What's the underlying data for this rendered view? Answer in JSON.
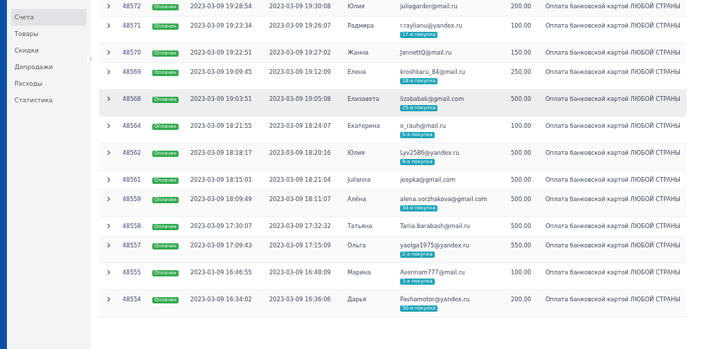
{
  "sidebar": {
    "items": [
      {
        "label": "Счета",
        "selected": true
      },
      {
        "label": "Товары",
        "selected": false
      },
      {
        "label": "Скидки",
        "selected": false
      },
      {
        "label": "Допродажи",
        "selected": false
      },
      {
        "label": "Расходы",
        "selected": false
      },
      {
        "label": "Статистика",
        "selected": false
      }
    ]
  },
  "table": {
    "rows": [
      {
        "id": "48572",
        "status": "Оплачен",
        "created": "2023-03-09 19:28:54",
        "paid": "2023-03-09 19:30:08",
        "name": "Юлия",
        "email": "juliagarder@mail.ru",
        "amount": "200.00",
        "payment": "Оплата банковской картой ЛЮБОЙ СТРАНЫ",
        "hovered": false
      },
      {
        "id": "48571",
        "status": "Оплачен",
        "created": "2023-03-09 19:23:34",
        "paid": "2023-03-09 19:26:07",
        "name": "Радмира",
        "email": "r.raylianu@yandex.ru",
        "badge": "17-я покупка",
        "amount": "100.00",
        "payment": "Оплата банковской картой ЛЮБОЙ СТРАНЫ",
        "hovered": false
      },
      {
        "id": "48570",
        "status": "Оплачен",
        "created": "2023-03-09 19:22:51",
        "paid": "2023-03-09 19:27:02",
        "name": "Жанна",
        "email": "JannettQ@mail.ru",
        "amount": "150.00",
        "payment": "Оплата банковской картой ЛЮБОЙ СТРАНЫ",
        "hovered": false
      },
      {
        "id": "48569",
        "status": "Оплачен",
        "created": "2023-03-09 19:09:45",
        "paid": "2023-03-09 19:12:09",
        "name": "Елена",
        "email": "kroshkaru_84@mail.ru",
        "badge": "18-я покупка",
        "amount": "250.00",
        "payment": "Оплата банковской картой ЛЮБОЙ СТРАНЫ",
        "hovered": false
      },
      {
        "id": "48568",
        "status": "Оплачен",
        "created": "2023-03-09 19:03:51",
        "paid": "2023-03-09 19:05:08",
        "name": "Елизавета",
        "email": "lizababak@gmail.com",
        "badge": "25-я покупка",
        "amount": "500.00",
        "payment": "Оплата банковской картой ЛЮБОЙ СТРАНЫ",
        "hovered": true
      },
      {
        "id": "48564",
        "status": "Оплачен",
        "created": "2023-03-09 18:21:55",
        "paid": "2023-03-09 18:24:07",
        "name": "Екатерина",
        "email": "e_rauh@mail.ru",
        "badge": "5-я покупка",
        "amount": "100.00",
        "payment": "Оплата банковской картой ЛЮБОЙ СТРАНЫ",
        "hovered": false
      },
      {
        "id": "48562",
        "status": "Оплачен",
        "created": "2023-03-09 18:18:17",
        "paid": "2023-03-09 18:20:16",
        "name": "Юлия",
        "email": "Lyv2586@yandex.ru",
        "badge": "9-я покупка",
        "amount": "500.00",
        "payment": "Оплата банковской картой ЛЮБОЙ СТРАНЫ",
        "hovered": false
      },
      {
        "id": "48561",
        "status": "Оплачен",
        "created": "2023-03-09 18:15:01",
        "paid": "2023-03-09 18:21:04",
        "name": "Julianna",
        "email": "jeepka@gmail.com",
        "amount": "500.00",
        "payment": "Оплата банковской картой ЛЮБОЙ СТРАНЫ",
        "hovered": false
      },
      {
        "id": "48559",
        "status": "Оплачен",
        "created": "2023-03-09 18:09:49",
        "paid": "2023-03-09 18:11:07",
        "name": "Алёна",
        "email": "alena.vorzhakova@gmail.com",
        "badge": "34-я покупка",
        "amount": "500.00",
        "payment": "Оплата банковской картой ЛЮБОЙ СТРАНЫ",
        "hovered": false
      },
      {
        "id": "48558",
        "status": "Оплачен",
        "created": "2023-03-09 17:30:07",
        "paid": "2023-03-09 17:32:32",
        "name": "Татьяна",
        "email": "Tania.barabash@mail.ru",
        "amount": "500.00",
        "payment": "Оплата банковской картой ЛЮБОЙ СТРАНЫ",
        "hovered": false
      },
      {
        "id": "48557",
        "status": "Оплачен",
        "created": "2023-03-09 17:09:43",
        "paid": "2023-03-09 17:15:09",
        "name": "Ольга",
        "email": "yaolga1975@yandex.ru",
        "badge": "2-я покупка",
        "amount": "550.00",
        "payment": "Оплата банковской картой ЛЮБОЙ СТРАНЫ",
        "hovered": false
      },
      {
        "id": "48555",
        "status": "Оплачен",
        "created": "2023-03-09 16:46:55",
        "paid": "2023-03-09 16:48:09",
        "name": "Марина",
        "email": "Averinam777@mail.ru",
        "badge": "3-я покупка",
        "amount": "100.00",
        "payment": "Оплата банковской картой ЛЮБОЙ СТРАНЫ",
        "hovered": false
      },
      {
        "id": "48554",
        "status": "Оплачен",
        "created": "2023-03-09 16:34:02",
        "paid": "2023-03-09 16:36:06",
        "name": "Дарья",
        "email": "Pashamotor@yandex.ru",
        "badge": "30-я покупка",
        "amount": "200.00",
        "payment": "Оплата банковской картой ЛЮБОЙ СТРАНЫ",
        "hovered": false
      }
    ]
  }
}
